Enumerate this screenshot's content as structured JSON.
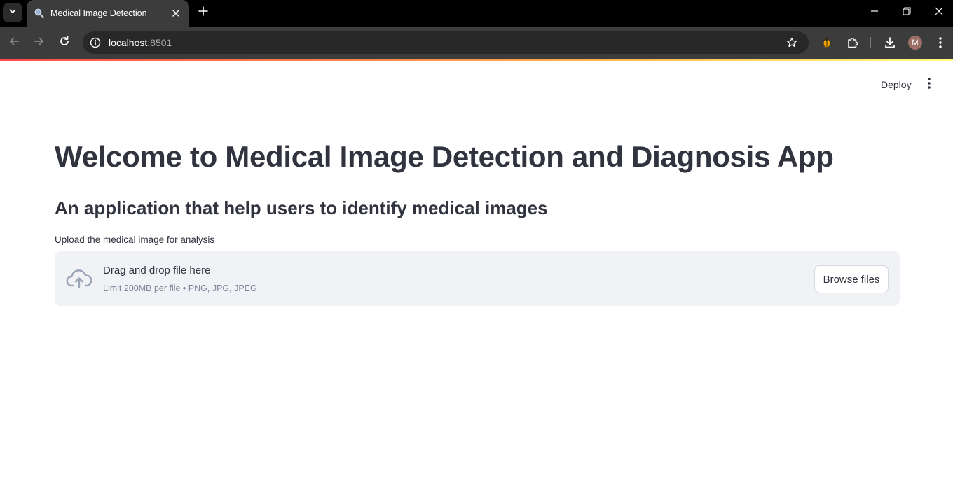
{
  "browser": {
    "tab_title": "Medical Image Detection",
    "url_host": "localhost",
    "url_port": ":8501",
    "profile_initial": "M",
    "icons": {
      "tab_list": "chevron-down-icon",
      "favicon": "magnifier-icon",
      "tab_close": "close-icon",
      "new_tab": "plus-icon",
      "minimize": "minimize-icon",
      "restore": "restore-icon",
      "close_window": "close-icon",
      "back": "arrow-left-icon",
      "forward": "arrow-right-icon",
      "reload": "reload-icon",
      "site_info": "info-icon",
      "bookmark": "star-icon",
      "extension_bug": "bug-extension-icon",
      "extensions": "puzzle-icon",
      "downloads": "download-icon",
      "menu": "kebab-menu-icon"
    }
  },
  "header": {
    "deploy_label": "Deploy"
  },
  "main": {
    "title": "Welcome to Medical Image Detection and Diagnosis App",
    "subtitle": "An application that help users to identify medical images",
    "uploader": {
      "label": "Upload the medical image for analysis",
      "drop_text": "Drag and drop file here",
      "limit_text": "Limit 200MB per file • PNG, JPG, JPEG",
      "browse_label": "Browse files",
      "icon": "cloud-upload-icon"
    }
  },
  "colors": {
    "text": "#31333f",
    "muted": "#808495",
    "dropzone_bg": "#f0f2f6",
    "accent_gradient": [
      "#ff4b4b",
      "#ffa44b",
      "#fffd80"
    ]
  }
}
